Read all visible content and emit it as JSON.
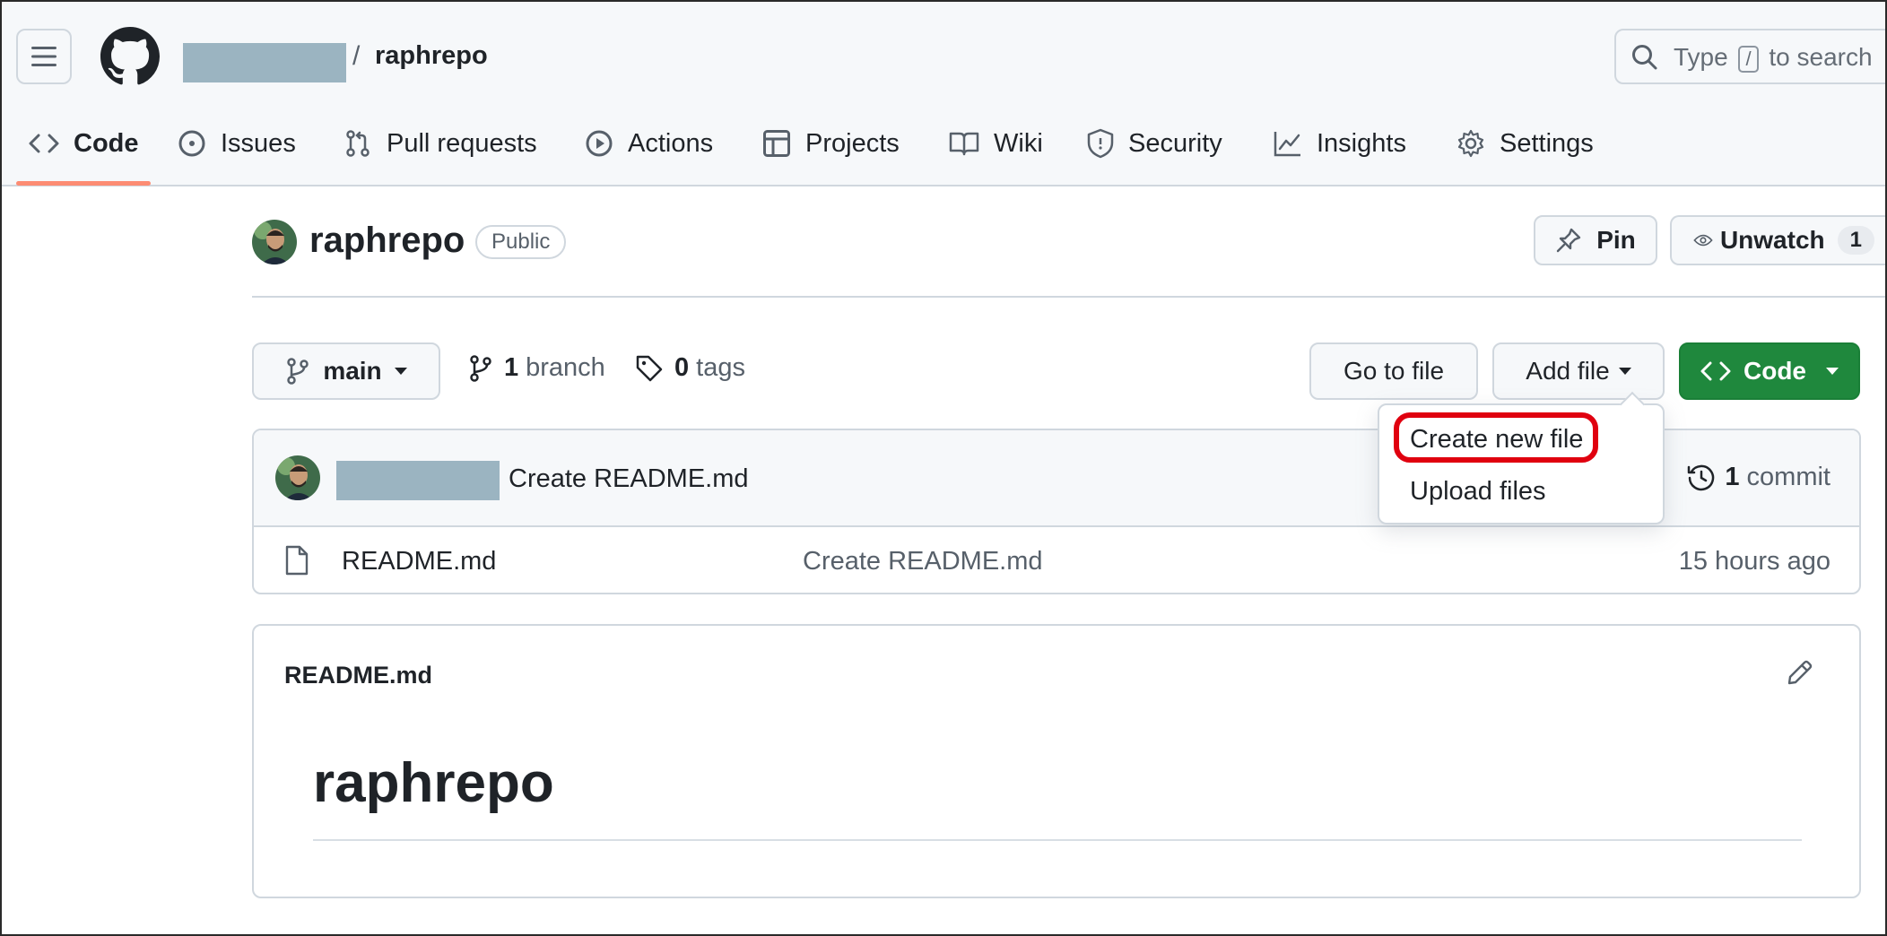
{
  "header": {
    "breadcrumb_separator": "/",
    "repo_name": "raphrepo",
    "search_prefix": "Type",
    "search_key": "/",
    "search_suffix": "to search"
  },
  "nav": {
    "tabs": [
      {
        "label": "Code",
        "icon": "code-icon"
      },
      {
        "label": "Issues",
        "icon": "issue-icon"
      },
      {
        "label": "Pull requests",
        "icon": "pull-request-icon"
      },
      {
        "label": "Actions",
        "icon": "play-icon"
      },
      {
        "label": "Projects",
        "icon": "table-icon"
      },
      {
        "label": "Wiki",
        "icon": "book-icon"
      },
      {
        "label": "Security",
        "icon": "shield-icon"
      },
      {
        "label": "Insights",
        "icon": "graph-icon"
      },
      {
        "label": "Settings",
        "icon": "gear-icon"
      }
    ],
    "active_tab": "Code"
  },
  "repo": {
    "title": "raphrepo",
    "visibility": "Public",
    "pin_label": "Pin",
    "unwatch_label": "Unwatch",
    "watch_count": "1"
  },
  "controls": {
    "branch": "main",
    "branch_count": "1",
    "branch_label": "branch",
    "tag_count": "0",
    "tag_label": "tags",
    "goto_file": "Go to file",
    "add_file": "Add file",
    "code": "Code"
  },
  "add_file_menu": {
    "items": [
      "Create new file",
      "Upload files"
    ],
    "highlighted": "Create new file"
  },
  "latest_commit": {
    "message": "Create README.md",
    "commit_count": "1",
    "commit_label": "commit"
  },
  "files": [
    {
      "name": "README.md",
      "commit_message": "Create README.md",
      "age": "15 hours ago"
    }
  ],
  "readme": {
    "file_name": "README.md",
    "heading": "raphrepo"
  },
  "colors": {
    "primary_button": "#1f883d",
    "tab_underline": "#fd8c73",
    "highlight_ring": "#e0000f",
    "redaction": "#9bb4c1"
  }
}
